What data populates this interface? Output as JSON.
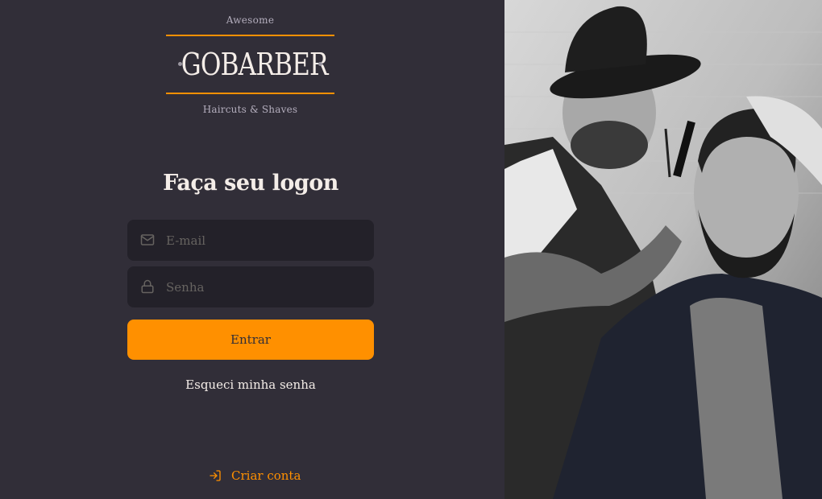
{
  "logo": {
    "tagline_top": "Awesome",
    "brand": "GOBARBER",
    "tagline_bottom": "Haircuts & Shaves"
  },
  "form": {
    "title": "Faça seu logon",
    "email_placeholder": "E-mail",
    "password_placeholder": "Senha",
    "submit_label": "Entrar",
    "forgot_label": "Esqueci minha senha"
  },
  "footer": {
    "create_account_label": "Criar conta"
  },
  "colors": {
    "background": "#312e38",
    "input_background": "#232129",
    "accent": "#ff9000",
    "text": "#f4ede8",
    "placeholder": "#666360"
  },
  "icons": {
    "email": "mail-icon",
    "password": "lock-icon",
    "create": "log-in-icon"
  }
}
